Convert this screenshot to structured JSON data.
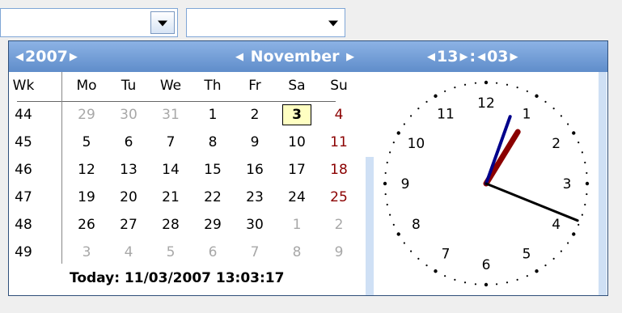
{
  "header": {
    "year": "2007",
    "month": "November",
    "hour": "13",
    "minute": "03",
    "time_separator": ":"
  },
  "calendar": {
    "week_header": "Wk",
    "day_headers": [
      "Mo",
      "Tu",
      "We",
      "Th",
      "Fr",
      "Sa",
      "Su"
    ],
    "weeks": [
      {
        "wk": "44",
        "days": [
          {
            "d": "29",
            "o": true
          },
          {
            "d": "30",
            "o": true
          },
          {
            "d": "31",
            "o": true
          },
          {
            "d": "1"
          },
          {
            "d": "2"
          },
          {
            "d": "3",
            "sel": true
          },
          {
            "d": "4",
            "sun": true
          }
        ]
      },
      {
        "wk": "45",
        "days": [
          {
            "d": "5"
          },
          {
            "d": "6"
          },
          {
            "d": "7"
          },
          {
            "d": "8"
          },
          {
            "d": "9"
          },
          {
            "d": "10"
          },
          {
            "d": "11",
            "sun": true
          }
        ]
      },
      {
        "wk": "46",
        "days": [
          {
            "d": "12"
          },
          {
            "d": "13"
          },
          {
            "d": "14"
          },
          {
            "d": "15"
          },
          {
            "d": "16"
          },
          {
            "d": "17"
          },
          {
            "d": "18",
            "sun": true
          }
        ]
      },
      {
        "wk": "47",
        "days": [
          {
            "d": "19"
          },
          {
            "d": "20"
          },
          {
            "d": "21"
          },
          {
            "d": "22"
          },
          {
            "d": "23"
          },
          {
            "d": "24"
          },
          {
            "d": "25",
            "sun": true
          }
        ]
      },
      {
        "wk": "48",
        "days": [
          {
            "d": "26"
          },
          {
            "d": "27"
          },
          {
            "d": "28"
          },
          {
            "d": "29"
          },
          {
            "d": "30"
          },
          {
            "d": "1",
            "o": true
          },
          {
            "d": "2",
            "o": true
          }
        ]
      },
      {
        "wk": "49",
        "days": [
          {
            "d": "3",
            "o": true
          },
          {
            "d": "4",
            "o": true
          },
          {
            "d": "5",
            "o": true
          },
          {
            "d": "6",
            "o": true
          },
          {
            "d": "7",
            "o": true
          },
          {
            "d": "8",
            "o": true
          },
          {
            "d": "9",
            "o": true
          }
        ]
      }
    ]
  },
  "today_label": "Today: 11/03/2007 13:03:17",
  "clock": {
    "numbers": [
      "12",
      "1",
      "2",
      "3",
      "4",
      "5",
      "6",
      "7",
      "8",
      "9",
      "10",
      "11"
    ],
    "hour": 13,
    "minute": 3,
    "second": 17,
    "colors": {
      "hour_hand": "#8b0000",
      "minute_hand": "#00008b",
      "second_hand": "#000000"
    }
  },
  "colors": {
    "accent": "#5f8dca",
    "selected_bg": "#ffffc2",
    "sunday": "#8b0000",
    "other_month": "#a8a8a8"
  }
}
